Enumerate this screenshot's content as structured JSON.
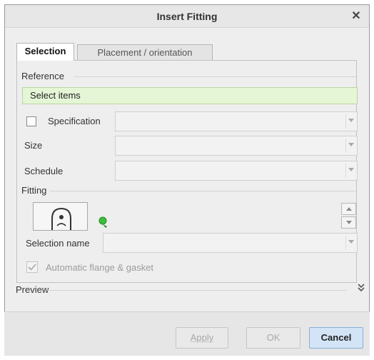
{
  "window": {
    "title": "Insert Fitting",
    "close_glyph": "✕"
  },
  "tabs": [
    {
      "label": "Selection",
      "active": true
    },
    {
      "label": "Placement / orientation",
      "active": false
    }
  ],
  "reference": {
    "section_label": "Reference",
    "value": "Select items",
    "highlight_color": "#e5f6d6"
  },
  "specification": {
    "label": "Specification",
    "checked": false,
    "value": ""
  },
  "size": {
    "label": "Size",
    "value": ""
  },
  "schedule": {
    "label": "Schedule",
    "value": ""
  },
  "fitting": {
    "section_label": "Fitting",
    "thumbnail_icon": "fitting-preview-icon",
    "status_icon": "green-pin-icon"
  },
  "selection_name": {
    "label": "Selection name",
    "value": ""
  },
  "auto_flange": {
    "label": "Automatic flange & gasket",
    "checked": true,
    "disabled": true
  },
  "preview": {
    "label": "Preview",
    "expand_glyph": "»"
  },
  "buttons": {
    "apply": "Apply",
    "ok": "OK",
    "cancel": "Cancel"
  }
}
